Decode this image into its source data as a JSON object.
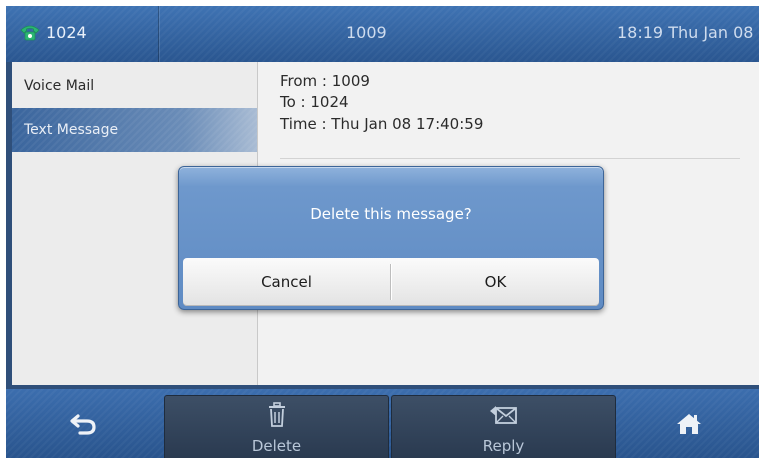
{
  "status_bar": {
    "account": "1024",
    "title": "1009",
    "clock": "18:19 Thu Jan 08",
    "icon": "phone-icon"
  },
  "sidebar": {
    "items": [
      {
        "label": "Voice Mail",
        "selected": false
      },
      {
        "label": "Text Message",
        "selected": true
      }
    ]
  },
  "message": {
    "from": "From : 1009",
    "to": "To : 1024",
    "time": "Time : Thu Jan 08 17:40:59"
  },
  "dialog": {
    "text": "Delete this message?",
    "cancel_label": "Cancel",
    "ok_label": "OK"
  },
  "softkeys": {
    "back_icon": "back-arrow-icon",
    "delete_label": "Delete",
    "delete_icon": "trash-icon",
    "reply_label": "Reply",
    "reply_icon": "envelope-reply-icon",
    "home_icon": "home-icon"
  },
  "colors": {
    "status_bar": "#3a6aa8",
    "phone_icon": "#2bb673",
    "selected_item": "#3a659d",
    "dialog": "#6e98cc"
  }
}
